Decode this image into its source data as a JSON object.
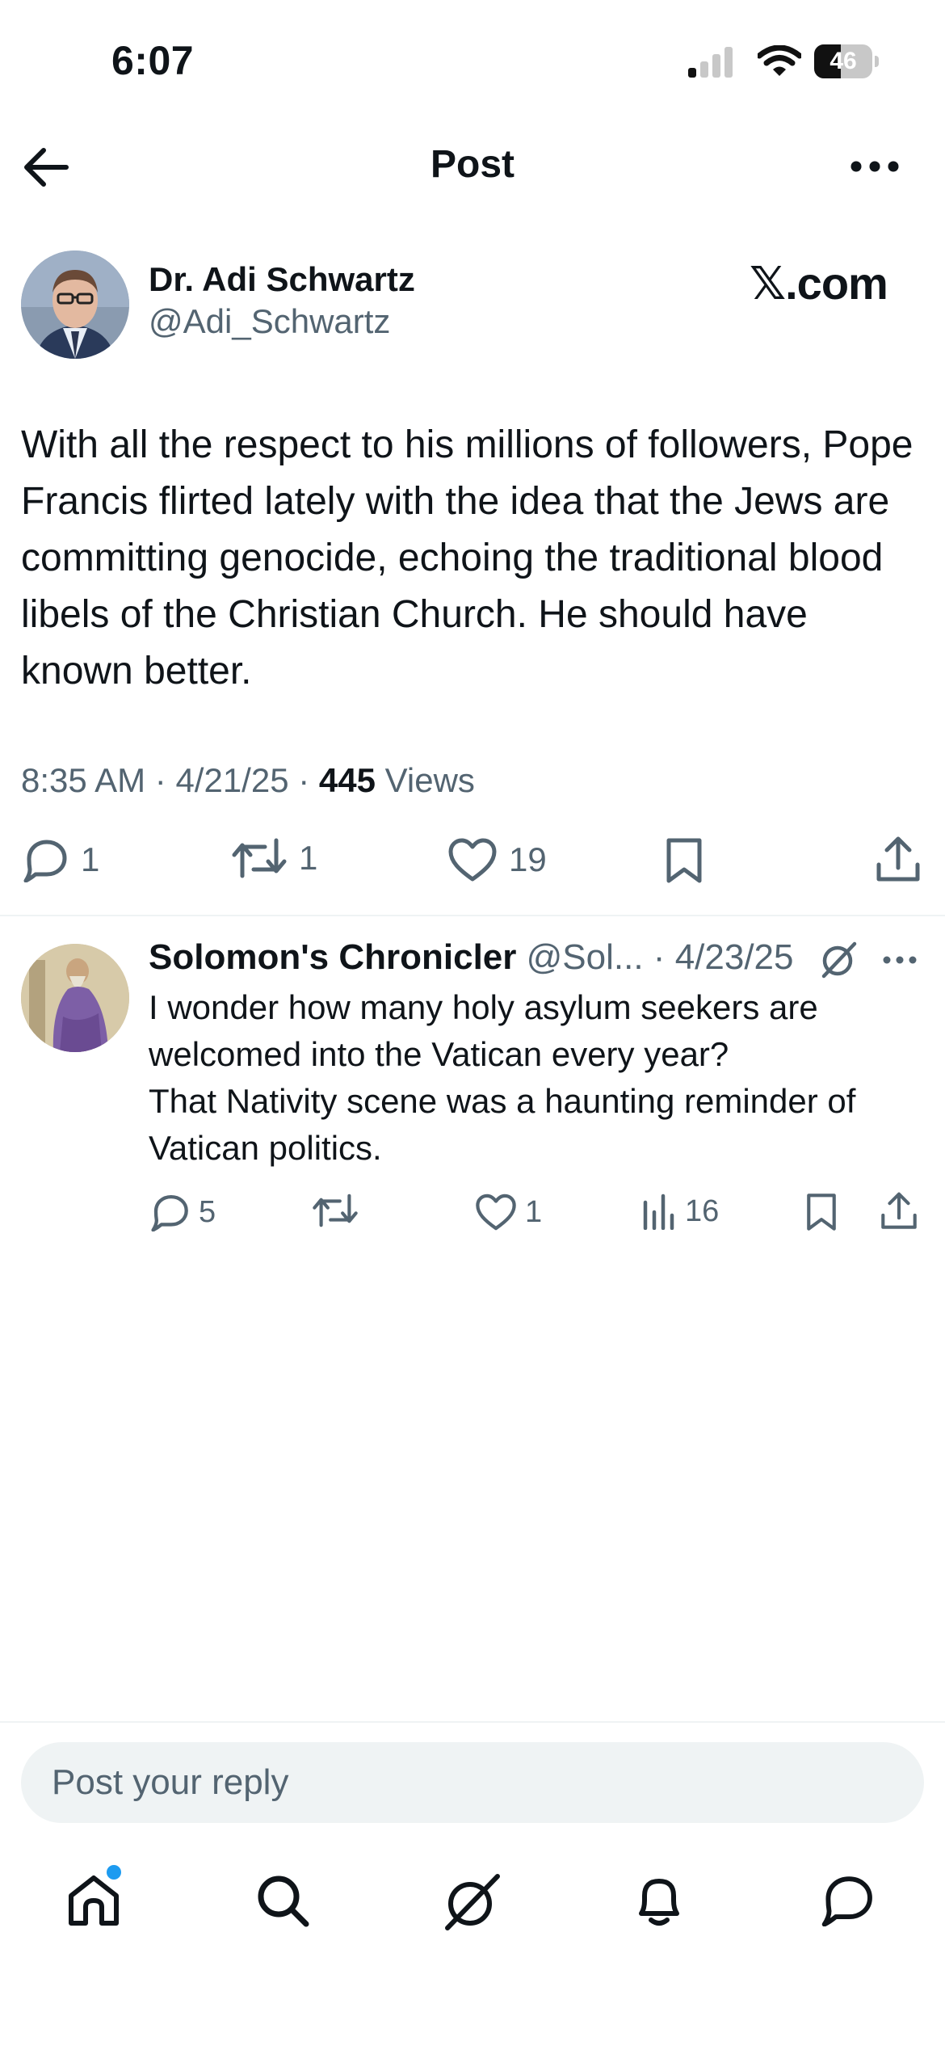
{
  "status_bar": {
    "time": "6:07",
    "battery_level": "46"
  },
  "nav": {
    "title": "Post"
  },
  "post": {
    "author_name": "Dr. Adi Schwartz",
    "author_handle": "@Adi_Schwartz",
    "source_label": "𝕏.com",
    "text": "With all the respect to his millions of followers, Pope Francis flirted lately with the idea that the Jews are committing genocide, echoing the traditional blood libels of the Christian Church. He should have known better.",
    "time": "8:35 AM",
    "date": "4/21/25",
    "views_count": "445",
    "views_label": "Views",
    "replies": "1",
    "reposts": "1",
    "likes": "19"
  },
  "reply": {
    "author_name": "Solomon's Chronicler",
    "author_handle": "@Sol...",
    "date": "4/23/25",
    "text_line1": "I wonder how many holy asylum seekers are welcomed into the Vatican every year?",
    "text_line2": "That Nativity scene was a haunting reminder of Vatican politics.",
    "replies": "5",
    "likes": "1",
    "views": "16"
  },
  "composer": {
    "placeholder": "Post your reply"
  },
  "colors": {
    "accent": "#1d9bf0",
    "secondary_text": "#536471",
    "primary_text": "#0f1419"
  }
}
